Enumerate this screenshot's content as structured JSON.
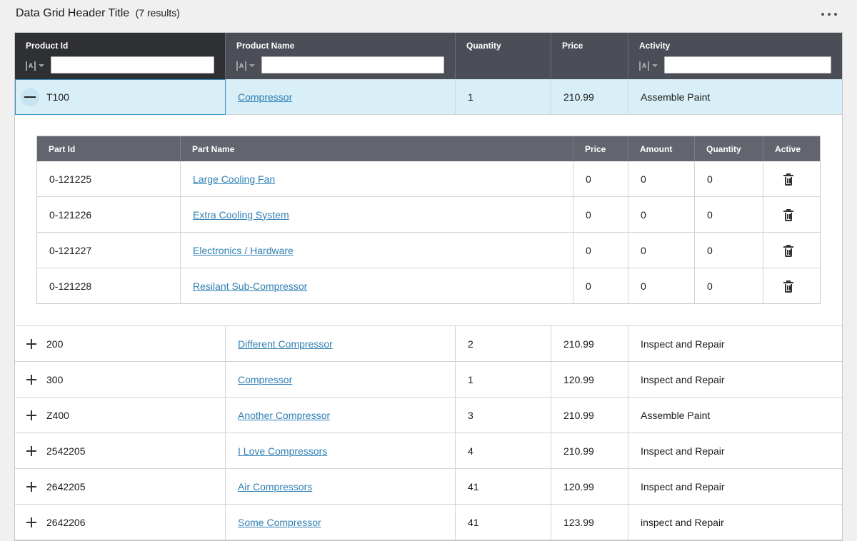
{
  "header": {
    "title": "Data Grid Header Title",
    "result_count": "(7 results)",
    "more_icon": "ellipsis-horizontal-icon"
  },
  "grid": {
    "columns": [
      {
        "label": "Product Id",
        "filterable": true
      },
      {
        "label": "Product Name",
        "filterable": true
      },
      {
        "label": "Quantity",
        "filterable": false
      },
      {
        "label": "Price",
        "filterable": false
      },
      {
        "label": "Activity",
        "filterable": true
      }
    ],
    "filter_icon": "text-filter-icon",
    "rows": [
      {
        "id": "T100",
        "name": "Compressor",
        "quantity": "1",
        "price": "210.99",
        "activity": "Assemble Paint",
        "expanded": true
      },
      {
        "id": "200",
        "name": "Different Compressor",
        "quantity": "2",
        "price": "210.99",
        "activity": "Inspect and Repair",
        "expanded": false
      },
      {
        "id": "300",
        "name": "Compressor",
        "quantity": "1",
        "price": "120.99",
        "activity": "Inspect and Repair",
        "expanded": false
      },
      {
        "id": "Z400",
        "name": "Another Compressor",
        "quantity": "3",
        "price": "210.99",
        "activity": "Assemble Paint",
        "expanded": false
      },
      {
        "id": "2542205",
        "name": "I Love Compressors",
        "quantity": "4",
        "price": "210.99",
        "activity": "Inspect and Repair",
        "expanded": false
      },
      {
        "id": "2642205",
        "name": "Air Compressors",
        "quantity": "41",
        "price": "120.99",
        "activity": "Inspect and Repair",
        "expanded": false
      },
      {
        "id": "2642206",
        "name": "Some Compressor",
        "quantity": "41",
        "price": "123.99",
        "activity": "inspect and Repair",
        "expanded": false
      }
    ]
  },
  "detail": {
    "columns": [
      "Part Id",
      "Part Name",
      "Price",
      "Amount",
      "Quantity",
      "Active"
    ],
    "delete_icon": "trash-icon",
    "rows": [
      {
        "part_id": "0-121225",
        "part_name": "Large Cooling Fan",
        "price": "0",
        "amount": "0",
        "quantity": "0"
      },
      {
        "part_id": "0-121226",
        "part_name": "Extra Cooling System",
        "price": "0",
        "amount": "0",
        "quantity": "0"
      },
      {
        "part_id": "0-121227",
        "part_name": "Electronics / Hardware",
        "price": "0",
        "amount": "0",
        "quantity": "0"
      },
      {
        "part_id": "0-121228",
        "part_name": "Resilant Sub-Compressor",
        "price": "0",
        "amount": "0",
        "quantity": "0"
      }
    ]
  },
  "colors": {
    "header_bg": "#4b4e56",
    "active_header_bg": "#2f3033",
    "selected_row_bg": "#d9eff7",
    "link": "#2d7fb3"
  }
}
